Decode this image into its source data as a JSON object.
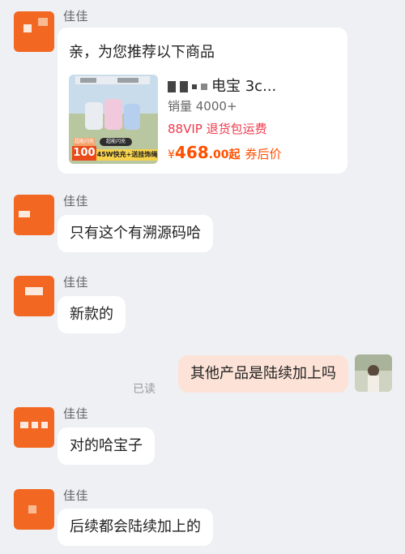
{
  "contact": {
    "name": "佳佳"
  },
  "messages": [
    {
      "type": "product_card",
      "sender": "佳佳",
      "intro": "亲，为您推荐以下商品",
      "product": {
        "name_visible": "电宝 3c...",
        "sales": "销量 4000+",
        "promo": "88VIP 退货包运费",
        "price_symbol": "¥",
        "price_int": "468",
        "price_dec": ".00",
        "price_suffix": "起",
        "price_note": "券后价",
        "thumb_tag": "超能闪充",
        "thumb_badge": "100",
        "thumb_strip": "45W快充+送挂饰绳"
      }
    },
    {
      "type": "text",
      "sender": "佳佳",
      "text": "只有这个有溯源码哈"
    },
    {
      "type": "text",
      "sender": "佳佳",
      "text": "新款的"
    },
    {
      "type": "text",
      "sender": "self",
      "text": "其他产品是陆续加上吗",
      "status": "已读"
    },
    {
      "type": "text",
      "sender": "佳佳",
      "text": "对的哈宝子"
    },
    {
      "type": "text",
      "sender": "佳佳",
      "text": "后续都会陆续加上的"
    }
  ],
  "colors": {
    "background": "#eef0f4",
    "avatar": "#f26822",
    "self_bubble": "#fde3d7",
    "price": "#ff5000",
    "vip": "#f0394b"
  }
}
